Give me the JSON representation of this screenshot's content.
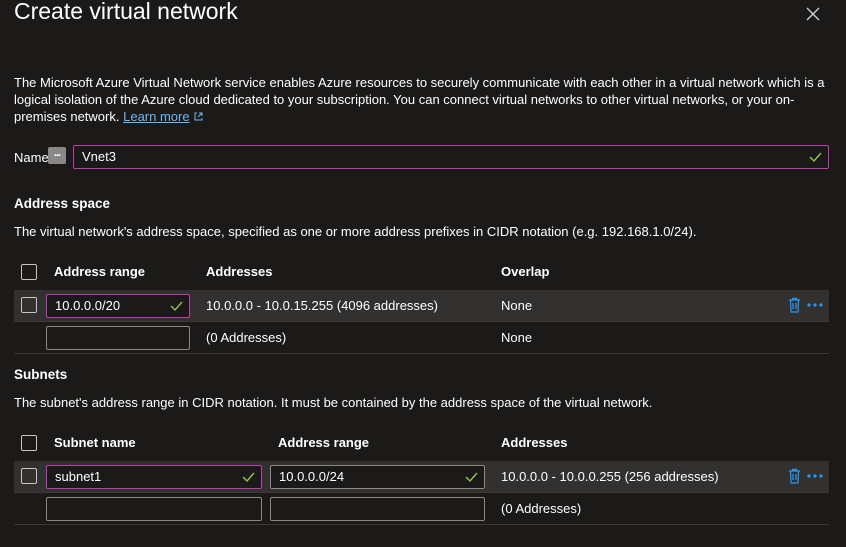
{
  "panel": {
    "title": "Create virtual network",
    "description": "The Microsoft Azure Virtual Network service enables Azure resources to securely communicate with each other in a virtual network which is a logical isolation of the Azure cloud dedicated to your subscription. You can connect virtual networks to other virtual networks, or your on-premises network.",
    "learn_more": "Learn more"
  },
  "name_field": {
    "label": "Name",
    "info_icon": "...",
    "value": "Vnet3"
  },
  "address_space": {
    "heading": "Address space",
    "description": "The virtual network's address space, specified as one or more address prefixes in CIDR notation (e.g. 192.168.1.0/24).",
    "columns": [
      "Address range",
      "Addresses",
      "Overlap"
    ],
    "rows": [
      {
        "range": "10.0.0.0/20",
        "addresses": "10.0.0.0 - 10.0.15.255 (4096 addresses)",
        "overlap": "None"
      },
      {
        "range": "",
        "addresses": "(0 Addresses)",
        "overlap": "None"
      }
    ]
  },
  "subnets": {
    "heading": "Subnets",
    "description": "The subnet's address range in CIDR notation. It must be contained by the address space of the virtual network.",
    "columns": [
      "Subnet name",
      "Address range",
      "Addresses"
    ],
    "rows": [
      {
        "name": "subnet1",
        "range": "10.0.0.0/24",
        "addresses": "10.0.0.0 - 10.0.0.255 (256 addresses)"
      },
      {
        "name": "",
        "range": "",
        "addresses": "(0 Addresses)"
      }
    ]
  },
  "colors": {
    "background": "#1b1a19",
    "row_highlight": "#323130",
    "valid_border": "#c239b3",
    "check": "#92c353",
    "link": "#6cb8f6",
    "action_blue": "#2899f5"
  },
  "icons": [
    "close-icon",
    "info-icon",
    "external-link-icon",
    "checkmark-icon",
    "trash-icon",
    "more-icon"
  ]
}
